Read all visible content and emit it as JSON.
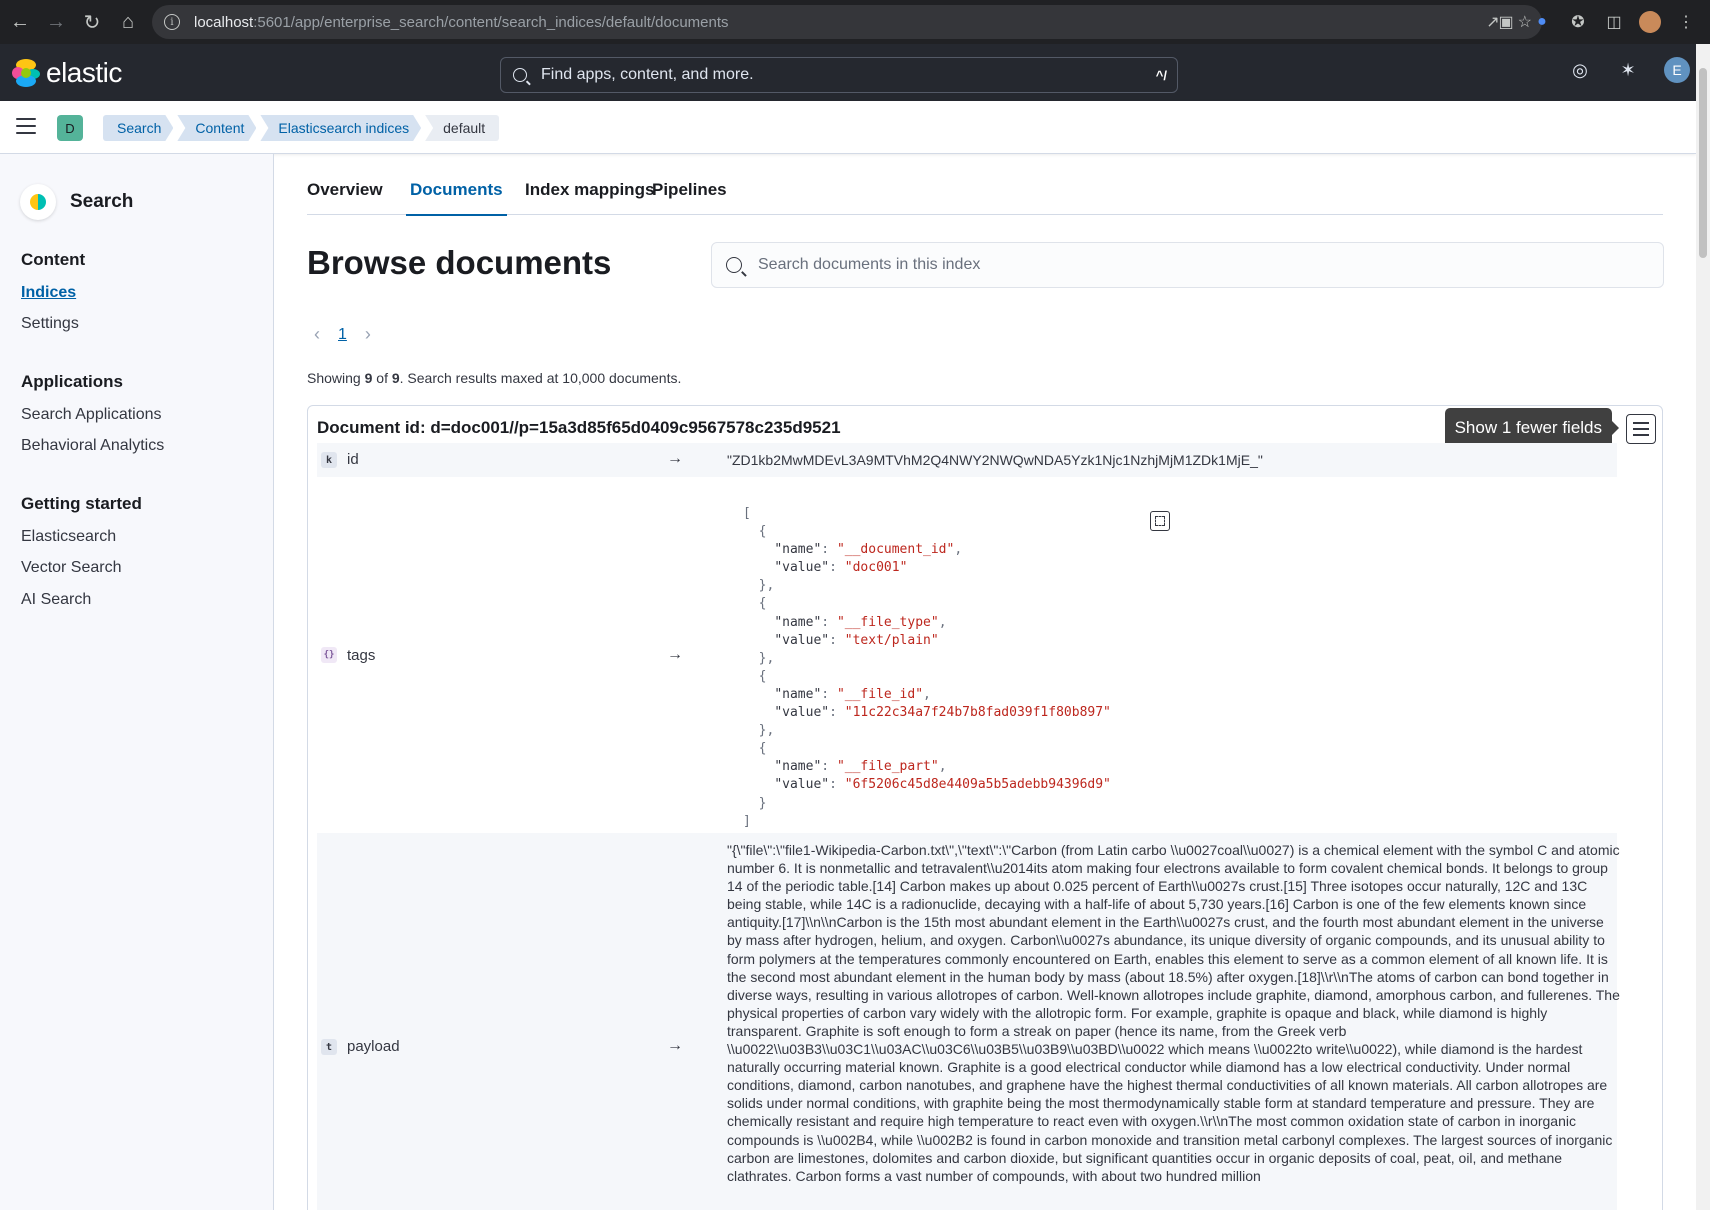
{
  "browser": {
    "url_host": "localhost",
    "url_rest": ":5601/app/enterprise_search/content/search_indices/default/documents"
  },
  "header": {
    "logo_text": "elastic",
    "search_placeholder": "Find apps, content, and more.",
    "search_shortcut": "^/",
    "user_initial": "E"
  },
  "breadcrumbs": {
    "space_initial": "D",
    "items": [
      "Search",
      "Content",
      "Elasticsearch indices",
      "default"
    ]
  },
  "sidebar": {
    "title": "Search",
    "groups": [
      {
        "label": "Content",
        "items": [
          "Indices",
          "Settings"
        ]
      },
      {
        "label": "Applications",
        "items": [
          "Search Applications",
          "Behavioral Analytics"
        ]
      },
      {
        "label": "Getting started",
        "items": [
          "Elasticsearch",
          "Vector Search",
          "AI Search"
        ]
      }
    ],
    "active_item": "Indices"
  },
  "tabs": [
    "Overview",
    "Documents",
    "Index mappings",
    "Pipelines"
  ],
  "active_tab": "Documents",
  "page_title": "Browse documents",
  "doc_search_placeholder": "Search documents in this index",
  "pagination": {
    "current_page": "1"
  },
  "results": {
    "showing_prefix": "Showing ",
    "shown": "9",
    "of": " of ",
    "total": "9",
    "suffix": ". Search results maxed at 10,000 documents."
  },
  "document": {
    "id_label": "Document id: d=doc001//p=15a3d85f65d0409c9567578c235d9521",
    "tooltip": "Show 1 fewer fields",
    "fields": [
      {
        "type": "k",
        "name": "id",
        "value": "\"ZD1kb2MwMDEvL3A9MTVhM2Q4NWY2NWQwNDA5Yzk1Njc1NzhjMjM1ZDk1MjE_\""
      },
      {
        "type": "{}",
        "name": "tags"
      },
      {
        "type": "t",
        "name": "payload"
      }
    ],
    "tags": [
      {
        "name": "__document_id",
        "value": "doc001"
      },
      {
        "name": "__file_type",
        "value": "text/plain"
      },
      {
        "name": "__file_id",
        "value": "11c22c34a7f24b7b8fad039f1f80b897"
      },
      {
        "name": "__file_part",
        "value": "6f5206c45d8e4409a5b5adebb94396d9"
      }
    ],
    "payload": "\"{\\\"file\\\":\\\"file1-Wikipedia-Carbon.txt\\\",\\\"text\\\":\\\"Carbon (from Latin carbo \\\\u0027coal\\\\u0027) is a chemical element with the symbol C and atomic number 6. It is nonmetallic and tetravalent\\\\u2014its atom making four electrons available to form covalent chemical bonds. It belongs to group 14 of the periodic table.[14] Carbon makes up about 0.025 percent of Earth\\\\u0027s crust.[15] Three isotopes occur naturally, 12C and 13C being stable, while 14C is a radionuclide, decaying with a half-life of about 5,730 years.[16] Carbon is one of the few elements known since antiquity.[17]\\\\n\\\\nCarbon is the 15th most abundant element in the Earth\\\\u0027s crust, and the fourth most abundant element in the universe by mass after hydrogen, helium, and oxygen. Carbon\\\\u0027s abundance, its unique diversity of organic compounds, and its unusual ability to form polymers at the temperatures commonly encountered on Earth, enables this element to serve as a common element of all known life. It is the second most abundant element in the human body by mass (about 18.5%) after oxygen.[18]\\\\r\\\\nThe atoms of carbon can bond together in diverse ways, resulting in various allotropes of carbon. Well-known allotropes include graphite, diamond, amorphous carbon, and fullerenes. The physical properties of carbon vary widely with the allotropic form. For example, graphite is opaque and black, while diamond is highly transparent. Graphite is soft enough to form a streak on paper (hence its name, from the Greek verb \\\\u0022\\\\u03B3\\\\u03C1\\\\u03AC\\\\u03C6\\\\u03B5\\\\u03B9\\\\u03BD\\\\u0022 which means \\\\u0022to write\\\\u0022), while diamond is the hardest naturally occurring material known. Graphite is a good electrical conductor while diamond has a low electrical conductivity. Under normal conditions, diamond, carbon nanotubes, and graphene have the highest thermal conductivities of all known materials. All carbon allotropes are solids under normal conditions, with graphite being the most thermodynamically stable form at standard temperature and pressure. They are chemically resistant and require high temperature to react even with oxygen.\\\\r\\\\nThe most common oxidation state of carbon in inorganic compounds is \\\\u002B4, while \\\\u002B2 is found in carbon monoxide and transition metal carbonyl complexes. The largest sources of inorganic carbon are limestones, dolomites and carbon dioxide, but significant quantities occur in organic deposits of coal, peat, oil, and methane clathrates. Carbon forms a vast number of compounds, with about two hundred million"
  },
  "colors": {
    "accent": "#0061a6",
    "header_bg": "#25282f",
    "chrome_bg": "#202124",
    "string_value": "#bd271e"
  }
}
